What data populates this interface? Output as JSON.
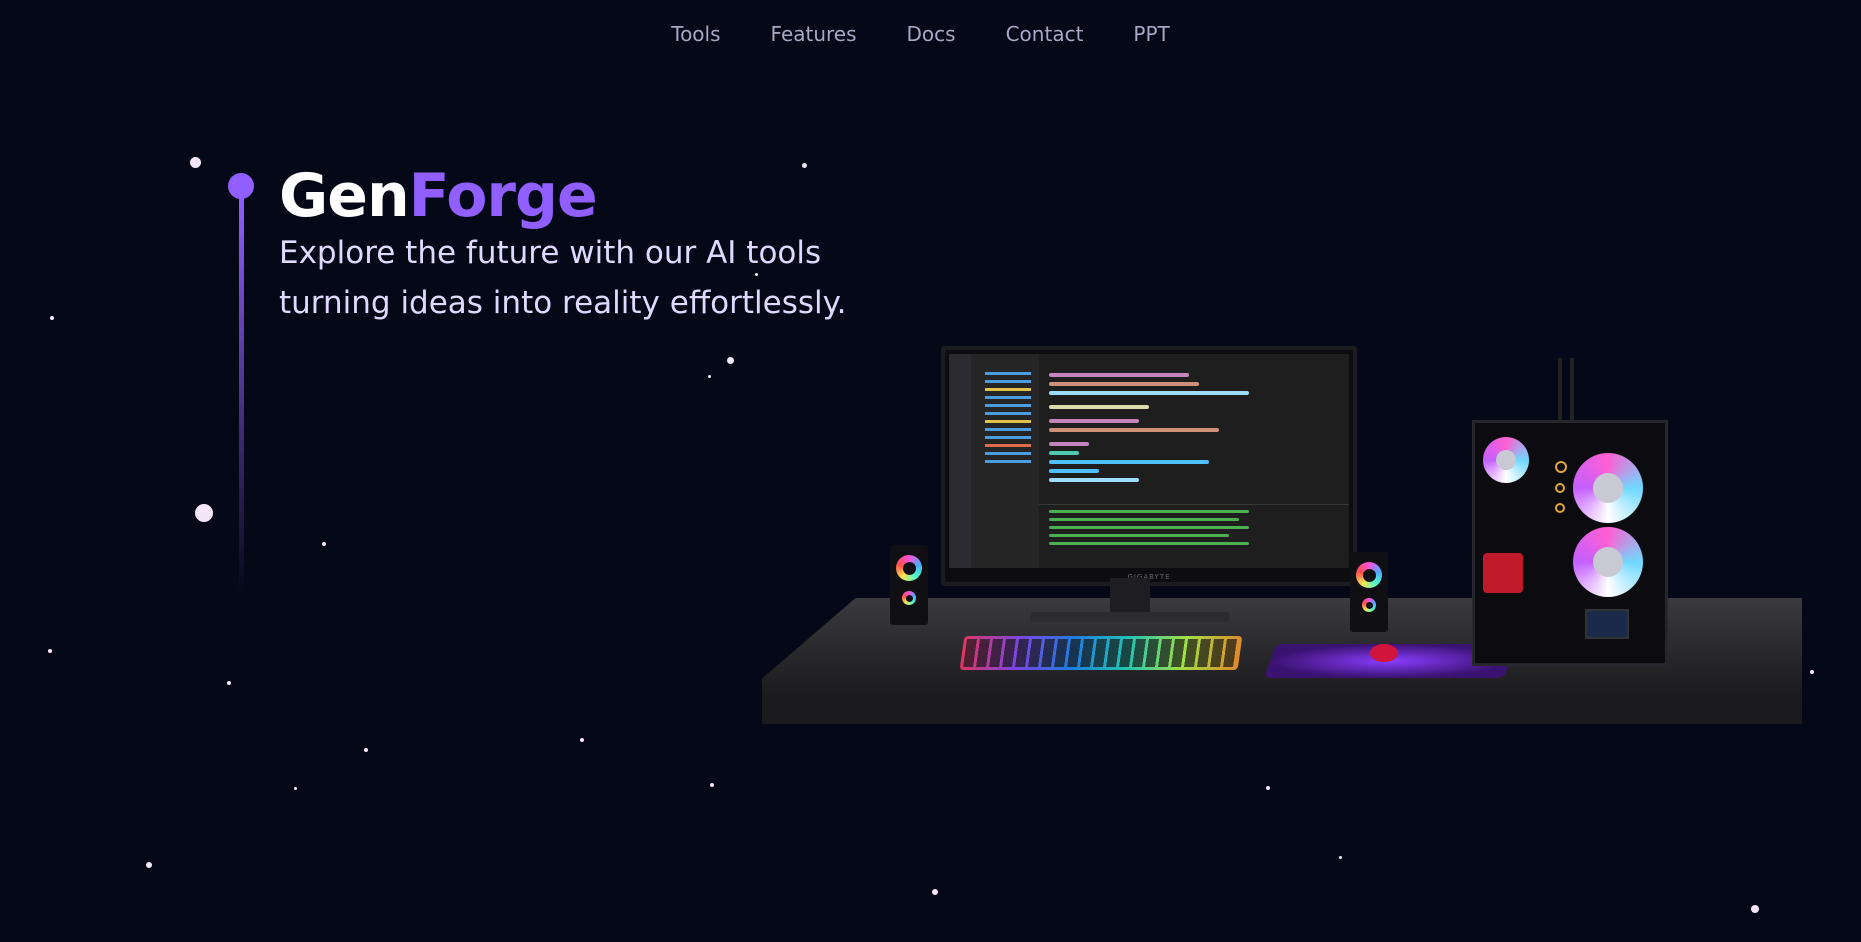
{
  "nav": {
    "items": [
      "Tools",
      "Features",
      "Docs",
      "Contact",
      "PPT"
    ]
  },
  "hero": {
    "title_part1": "Gen",
    "title_part2": "Forge",
    "subtitle_line1": "Explore the future with our AI tools",
    "subtitle_line2": "turning ideas into reality effortlessly."
  },
  "colors": {
    "background": "#050816",
    "accent": "#915eff",
    "nav_text": "#aaa6c3",
    "subtitle_text": "#dfd9ff"
  },
  "scene": {
    "monitor_brand": "GIGABYTE"
  }
}
